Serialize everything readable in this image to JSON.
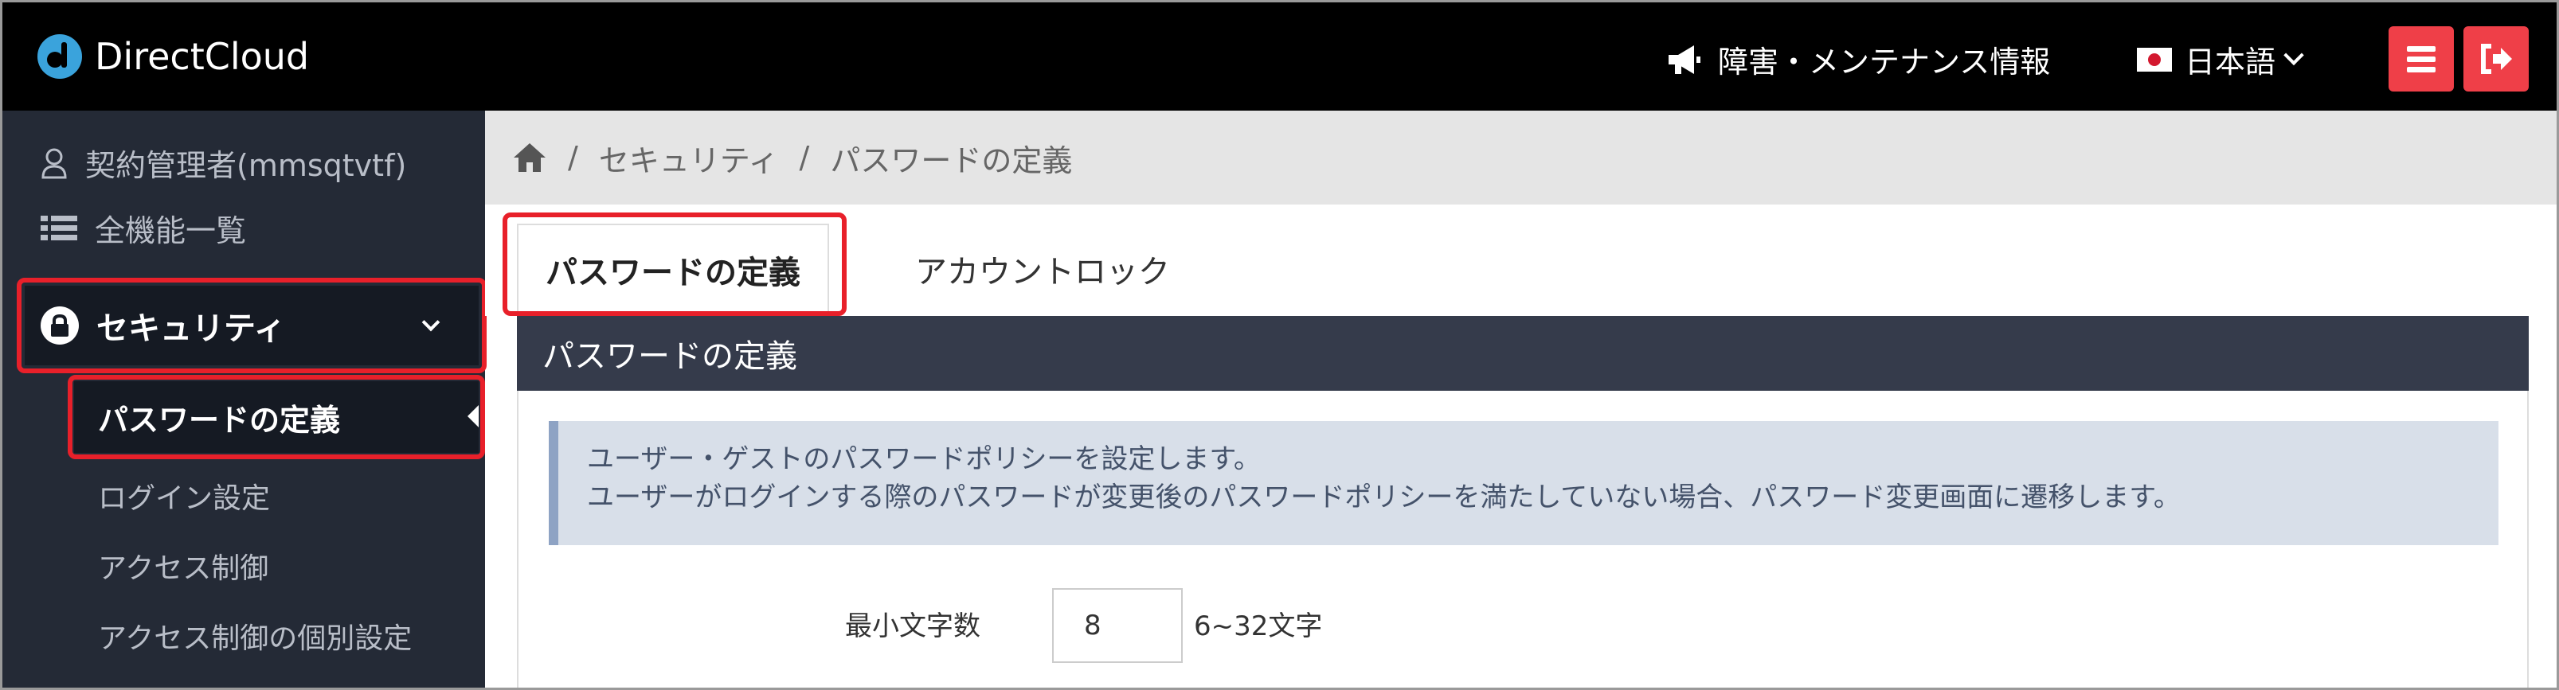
{
  "header": {
    "logo_text": "DirectCloud",
    "notice_label": "障害・メンテナンス情報",
    "language_label": "日本語",
    "menu_button_icon": "hamburger-icon",
    "logout_button_icon": "logout-icon",
    "accent_color": "#ef3f48"
  },
  "sidebar": {
    "user_label": "契約管理者(mmsqtvtf)",
    "all_functions_label": "全機能一覧",
    "section": {
      "label": "セキュリティ",
      "icon": "lock-icon"
    },
    "sub_items": [
      {
        "label": "パスワードの定義",
        "active": true
      },
      {
        "label": "ログイン設定",
        "active": false
      },
      {
        "label": "アクセス制御",
        "active": false
      },
      {
        "label": "アクセス制御の個別設定",
        "active": false
      }
    ]
  },
  "breadcrumb": {
    "items": [
      "セキュリティ",
      "パスワードの定義"
    ],
    "separator": "/"
  },
  "tabs": [
    {
      "label": "パスワードの定義",
      "active": true
    },
    {
      "label": "アカウントロック",
      "active": false
    }
  ],
  "panel": {
    "title": "パスワードの定義",
    "info_lines": [
      "ユーザー・ゲストのパスワードポリシーを設定します。",
      "ユーザーがログインする際のパスワードが変更後のパスワードポリシーを満たしていない場合、パスワード変更画面に遷移します。"
    ],
    "min_length": {
      "label": "最小文字数",
      "value": "8",
      "hint": "6~32文字"
    }
  },
  "highlight_color": "#e8202a"
}
